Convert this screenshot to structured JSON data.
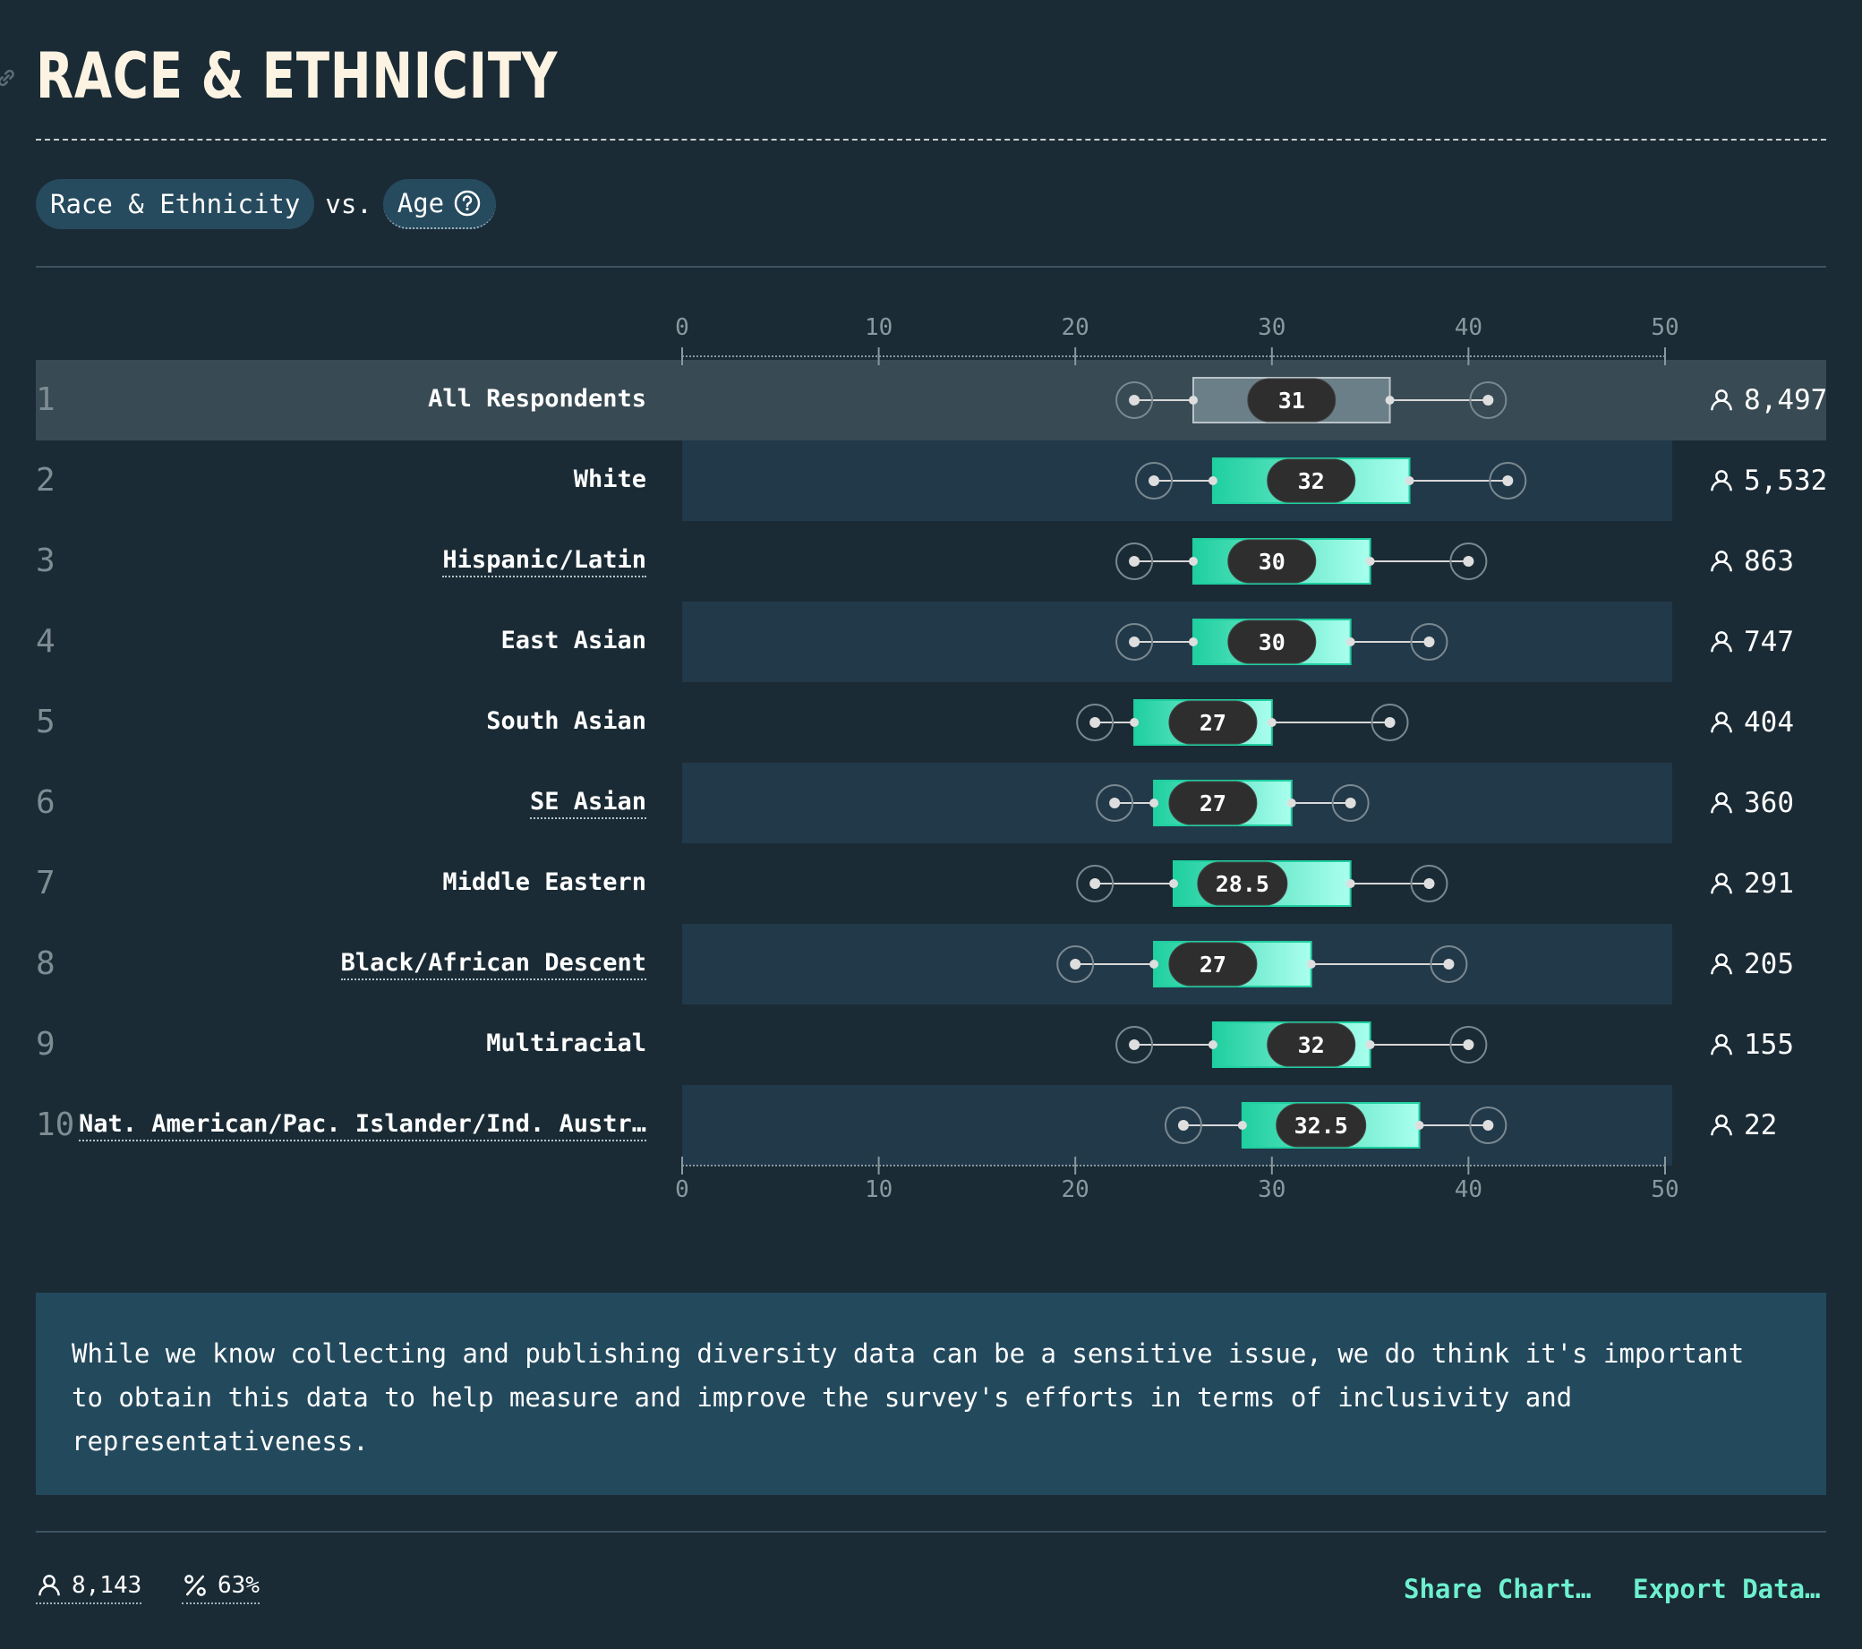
{
  "title": "RACE & ETHNICITY",
  "selector": {
    "primary": "Race & Ethnicity",
    "vs": "vs.",
    "secondary": "Age"
  },
  "chart_data": {
    "type": "boxplot",
    "x_ticks": [
      0,
      10,
      20,
      30,
      40,
      50
    ],
    "xlim": [
      0,
      50
    ],
    "rows": [
      {
        "rank": "1",
        "label": "All Respondents",
        "dotted": false,
        "highlight": true,
        "count": "8,497",
        "whisker_low": 23,
        "q1": 26,
        "median": 31,
        "median_label": "31",
        "q3": 36,
        "whisker_high": 41
      },
      {
        "rank": "2",
        "label": "White",
        "dotted": false,
        "highlight": false,
        "count": "5,532",
        "whisker_low": 24,
        "q1": 27,
        "median": 32,
        "median_label": "32",
        "q3": 37,
        "whisker_high": 42
      },
      {
        "rank": "3",
        "label": "Hispanic/Latin",
        "dotted": true,
        "highlight": false,
        "count": "863",
        "whisker_low": 23,
        "q1": 26,
        "median": 30,
        "median_label": "30",
        "q3": 35,
        "whisker_high": 40
      },
      {
        "rank": "4",
        "label": "East Asian",
        "dotted": false,
        "highlight": false,
        "count": "747",
        "whisker_low": 23,
        "q1": 26,
        "median": 30,
        "median_label": "30",
        "q3": 34,
        "whisker_high": 38
      },
      {
        "rank": "5",
        "label": "South Asian",
        "dotted": false,
        "highlight": false,
        "count": "404",
        "whisker_low": 21,
        "q1": 23,
        "median": 27,
        "median_label": "27",
        "q3": 30,
        "whisker_high": 36
      },
      {
        "rank": "6",
        "label": "SE Asian",
        "dotted": true,
        "highlight": false,
        "count": "360",
        "whisker_low": 22,
        "q1": 24,
        "median": 27,
        "median_label": "27",
        "q3": 31,
        "whisker_high": 34
      },
      {
        "rank": "7",
        "label": "Middle Eastern",
        "dotted": false,
        "highlight": false,
        "count": "291",
        "whisker_low": 21,
        "q1": 25,
        "median": 28.5,
        "median_label": "28.5",
        "q3": 34,
        "whisker_high": 38
      },
      {
        "rank": "8",
        "label": "Black/African Descent",
        "dotted": true,
        "highlight": false,
        "count": "205",
        "whisker_low": 20,
        "q1": 24,
        "median": 27,
        "median_label": "27",
        "q3": 32,
        "whisker_high": 39
      },
      {
        "rank": "9",
        "label": "Multiracial",
        "dotted": false,
        "highlight": false,
        "count": "155",
        "whisker_low": 23,
        "q1": 27,
        "median": 32,
        "median_label": "32",
        "q3": 35,
        "whisker_high": 40
      },
      {
        "rank": "10",
        "label": "Nat. American/Pac. Islander/Ind. Austr…",
        "dotted": true,
        "highlight": false,
        "count": "22",
        "whisker_low": 25.5,
        "q1": 28.5,
        "median": 32.5,
        "median_label": "32.5",
        "q3": 37.5,
        "whisker_high": 41
      }
    ]
  },
  "note": "While we know collecting and publishing diversity data can be a sensitive issue, we do think it's important to obtain this data to help measure and improve the survey's efforts in terms of inclusivity and representativeness.",
  "footer": {
    "respondents": "8,143",
    "percent": "63%",
    "share_label": "Share Chart…",
    "export_label": "Export Data…"
  },
  "colors": {
    "background": "#1a2b35",
    "box_gradient_start": "#1fcf9f",
    "box_gradient_end": "#aaffee",
    "highlight_box": "#6b7f88",
    "median_pill": "#2e2e2e",
    "link": "#6ef0cf"
  },
  "icons": {
    "link": "link-icon",
    "help": "question-circle-icon",
    "person": "person-icon",
    "percent": "percent-icon"
  }
}
